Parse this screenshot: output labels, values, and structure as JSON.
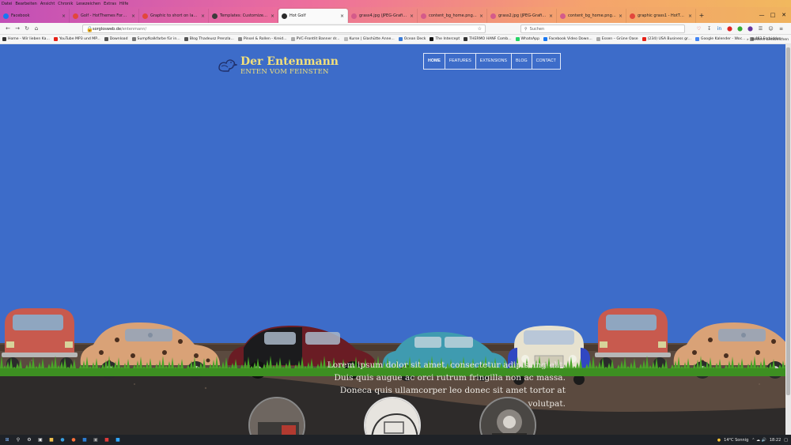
{
  "menu": [
    "Datei",
    "Bearbeiten",
    "Ansicht",
    "Chronik",
    "Lesezeichen",
    "Extras",
    "Hilfe"
  ],
  "tabs": [
    {
      "label": "Facebook",
      "color": "#1877f2",
      "active": false,
      "w": 88
    },
    {
      "label": "Golf - HotThemes Forum - Hot...",
      "color": "#e2473c",
      "active": false,
      "w": 88
    },
    {
      "label": "Graphic to short on large scree...",
      "color": "#e2473c",
      "active": false,
      "w": 88
    },
    {
      "label": "Templates: Customize (Golf) - ...",
      "color": "#3b3b3b",
      "active": false,
      "w": 88
    },
    {
      "label": "Hot Golf",
      "color": "#2b2b2b",
      "active": true,
      "w": 88
    },
    {
      "label": "grass4.jpg (JPEG-Grafik, 1920 ×...",
      "color": "#d45a8a",
      "active": false,
      "w": 88
    },
    {
      "label": "content_bg_home.png (PNG-Gr...",
      "color": "#d45a8a",
      "active": false,
      "w": 88
    },
    {
      "label": "grass2.jpg (JPEG-Grafik, 1920 ×...",
      "color": "#d45a8a",
      "active": false,
      "w": 88
    },
    {
      "label": "content_bg_home.png (PNG-Gr...",
      "color": "#d45a8a",
      "active": false,
      "w": 88
    },
    {
      "label": "graphic grass1 - HotThemes Fo...",
      "color": "#e2473c",
      "active": false,
      "w": 88
    }
  ],
  "url": {
    "host": "sorglosweb.de",
    "path": "/entenmann/"
  },
  "search_placeholder": "Suchen",
  "bookmarks": [
    {
      "label": "Home - Wir lieben Ka...",
      "color": "#333333"
    },
    {
      "label": "YouTube MP3 und MP...",
      "color": "#e62117"
    },
    {
      "label": "Download",
      "color": "#555555"
    },
    {
      "label": "Sumpfkalkfarbe für in...",
      "color": "#777777"
    },
    {
      "label": "Blog Thadeusz Prenzla...",
      "color": "#555555"
    },
    {
      "label": "Pinsel & Rollen - Kreid...",
      "color": "#888888"
    },
    {
      "label": "PVC-Frontlit Banner dr...",
      "color": "#aaaaaa"
    },
    {
      "label": "Kurse | Glashütte Anne...",
      "color": "#bbbbbb"
    },
    {
      "label": "Ocean Deck",
      "color": "#3b7bd6"
    },
    {
      "label": "The Intercept",
      "color": "#111111"
    },
    {
      "label": "THERMO HANF Comb...",
      "color": "#333333"
    },
    {
      "label": "WhatsApp",
      "color": "#25d366"
    },
    {
      "label": "Facebook Video Down...",
      "color": "#1877f2"
    },
    {
      "label": "Essen – Grüne Oase",
      "color": "#aaaaaa"
    },
    {
      "label": "(234) USA Business gr...",
      "color": "#e62117"
    },
    {
      "label": "Google Kalender - Woc...",
      "color": "#4285f4"
    },
    {
      "label": "403 Forbidden",
      "color": "#888888"
    }
  ],
  "bookmarks_more": "Weitere Lesezeichen",
  "site": {
    "title": "Der Entenmann",
    "tagline": "ENTEN VOM FEINSTEN",
    "nav": [
      "HOME",
      "FEATURES",
      "EXTENSIONS",
      "BLOG",
      "CONTACT"
    ],
    "lorem": "Lorem ipsum dolor sit amet, consectetur adipiscing elit. Duis quis augue ac orci rutrum fringilla non ac massa. Doneca quis ullamcorper leo donec sit amet tortor at volutpat.",
    "accent": "#f2e07a",
    "sky": "#3d6cc9"
  },
  "taskbar": {
    "weather": "14°C  Sonnig",
    "time": "18:22"
  }
}
